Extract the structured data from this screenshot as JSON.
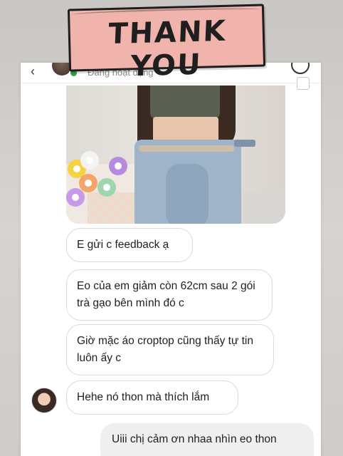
{
  "sticker": {
    "text": "THANK YOU"
  },
  "chat_header": {
    "status": "Đang hoạt động"
  },
  "messages": [
    {
      "text": "E gửi c feedback ạ"
    },
    {
      "text": "Eo của em giảm còn 62cm sau 2 gói  trà gạo bên mình đó c"
    },
    {
      "text": "Giờ mặc áo croptop cũng thấy tự tin luôn ấy c"
    },
    {
      "text": "Hehe nó thon mà thích lắm"
    }
  ],
  "outgoing_message": {
    "text": "Uiii chị cảm ơn nhaa nhìn eo thon"
  },
  "colors": {
    "sticker_background": "#f0b4ad",
    "online_indicator": "#31a24c",
    "status_text": "#8a8a8a",
    "outgoing_bubble": "#efefef"
  },
  "icons": {
    "back": "chevron-left-icon",
    "info": "info-icon",
    "select": "checkbox-icon"
  }
}
